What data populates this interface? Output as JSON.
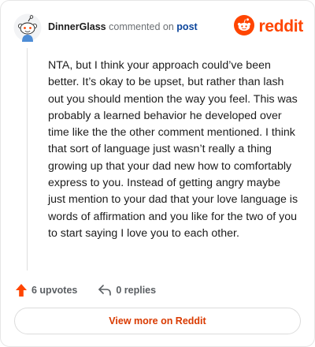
{
  "header": {
    "author": "DinnerGlass",
    "commented_on": "commented on",
    "post_link": "post",
    "brand_name": "reddit"
  },
  "comment": {
    "body": "NTA, but I think your approach could’ve been better. It’s okay to be upset, but rather than lash out you should mention the way you feel. This was probably a learned behavior he developed over time like the the other comment mentioned. I think that sort of language just wasn’t really a thing growing up that your dad new how to comfortably express to you. Instead of getting angry maybe just mention to your dad that your love language is words of affirmation and you like for the two of you to start saying I love you to each other."
  },
  "actions": {
    "upvotes": "6 upvotes",
    "replies": "0 replies"
  },
  "footer": {
    "view_more": "View more on Reddit"
  },
  "colors": {
    "brand": "#ff4500",
    "link": "#0a449b",
    "view_more": "#d93a00"
  },
  "icons": {
    "avatar": "snoo-avatar-icon",
    "brand": "reddit-logo-icon",
    "upvote": "upvote-arrow-icon",
    "reply": "reply-arrow-icon"
  }
}
